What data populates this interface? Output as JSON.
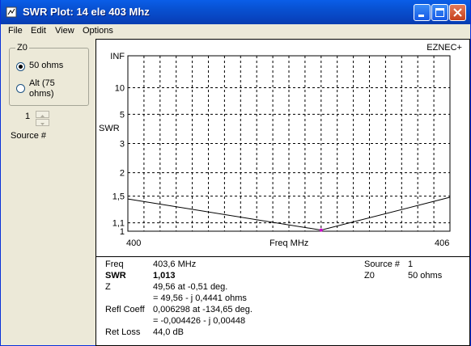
{
  "window": {
    "title": "SWR Plot: 14 ele 403 Mhz"
  },
  "menu": [
    "File",
    "Edit",
    "View",
    "Options"
  ],
  "z0_group": {
    "label": "Z0",
    "options": [
      {
        "label": "50 ohms",
        "checked": true
      },
      {
        "label": "Alt (75 ohms)",
        "checked": false
      }
    ]
  },
  "source": {
    "value": "1",
    "label": "Source #"
  },
  "plot": {
    "brand": "EZNEC+",
    "ylabel": "SWR",
    "xlabel": "Freq MHz",
    "x_start_label": "400",
    "x_end_label": "406",
    "y_tick_labels": [
      "INF",
      "10",
      "5",
      "3",
      "2",
      "1,5",
      "1,1",
      "1"
    ]
  },
  "chart_data": {
    "type": "line",
    "xlabel": "Freq MHz",
    "ylabel": "SWR",
    "xlim": [
      400,
      406
    ],
    "y_scale": "reflection-coefficient (SWR)",
    "y_ticks": [
      "INF",
      "10",
      "5",
      "3",
      "2",
      "1,5",
      "1,1",
      "1"
    ],
    "grid": true,
    "series": [
      {
        "x": [
          400,
          403.6,
          406
        ],
        "y": [
          1.45,
          1.013,
          1.48
        ]
      }
    ],
    "marker": {
      "x": 403.6,
      "y": 1.013,
      "color": "#cc00cc"
    }
  },
  "info": {
    "freq_label": "Freq",
    "freq_value": "403,6 MHz",
    "swr_label": "SWR",
    "swr_value": "1,013",
    "z_label": "Z",
    "z_value1": "49,56 at -0,51 deg.",
    "z_value2": "= 49,56 - j 0,4441 ohms",
    "refl_label": "Refl Coeff",
    "refl_value1": "0,006298 at -134,65 deg.",
    "refl_value2": "= -0,004426 - j 0,00448",
    "retloss_label": "Ret Loss",
    "retloss_value": "44,0 dB",
    "source_label": "Source #",
    "source_value": "1",
    "z0_label": "Z0",
    "z0_value": "50 ohms"
  }
}
